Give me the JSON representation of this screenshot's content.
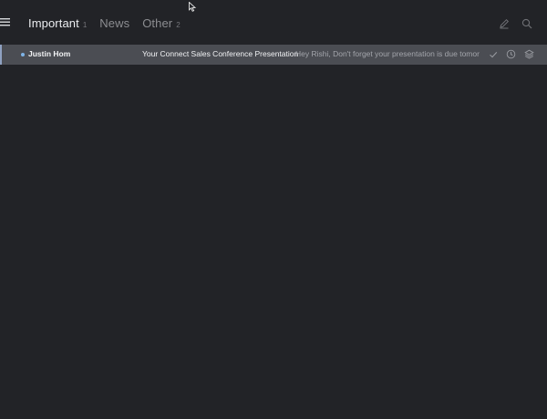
{
  "tabs": [
    {
      "label": "Important",
      "count": "1",
      "active": true
    },
    {
      "label": "News",
      "count": "",
      "active": false
    },
    {
      "label": "Other",
      "count": "2",
      "active": false
    }
  ],
  "toolbar": {
    "icons": [
      "menu-icon",
      "compose-icon",
      "search-icon"
    ]
  },
  "messages": [
    {
      "sender": "Justin Hom",
      "subject": "Your Connect Sales Conference Presentation",
      "snippet": "Hey Rishi, Don't forget your presentation is due tomorro...",
      "unread": true,
      "actions": [
        "check-icon",
        "snooze-icon",
        "move-icon"
      ]
    }
  ],
  "colors": {
    "background": "#222327",
    "row_selected": "#4b4d53",
    "unread_dot": "#7fb3e6",
    "text_primary": "#eceef1",
    "text_muted": "#8c8d91"
  }
}
